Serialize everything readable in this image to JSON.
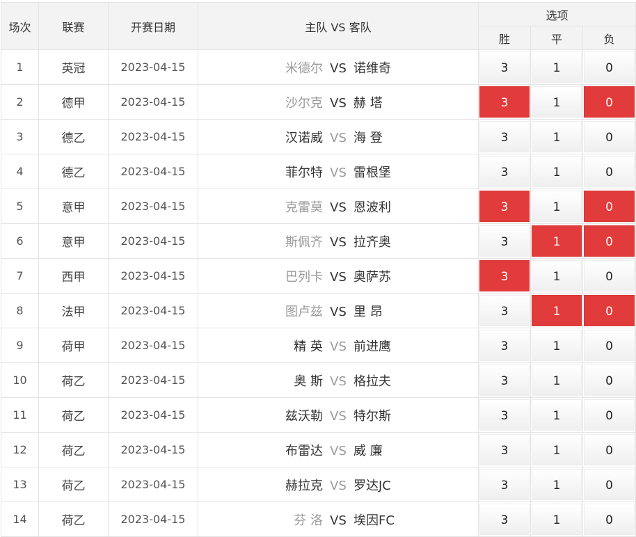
{
  "header": {
    "col_no": "场次",
    "col_league": "联赛",
    "col_date": "开赛日期",
    "col_match": "主队 VS 客队",
    "col_options": "选项",
    "opt_win": "胜",
    "opt_draw": "平",
    "opt_lose": "负"
  },
  "rows": [
    {
      "no": "1",
      "league": "英冠",
      "date": "2023-04-15",
      "home": "米德尔",
      "vs": "VS",
      "away": "诺维奇",
      "home_muted": true,
      "win": "3",
      "draw": "1",
      "lose": "0",
      "sel": [
        false,
        false,
        false
      ]
    },
    {
      "no": "2",
      "league": "德甲",
      "date": "2023-04-15",
      "home": "沙尔克",
      "vs": "VS",
      "away": "赫 塔",
      "home_muted": true,
      "win": "3",
      "draw": "1",
      "lose": "0",
      "sel": [
        true,
        false,
        true
      ]
    },
    {
      "no": "3",
      "league": "德乙",
      "date": "2023-04-15",
      "home": "汉诺威",
      "vs": "VS",
      "away": "海 登",
      "home_muted": false,
      "win": "3",
      "draw": "1",
      "lose": "0",
      "sel": [
        false,
        false,
        false
      ]
    },
    {
      "no": "4",
      "league": "德乙",
      "date": "2023-04-15",
      "home": "菲尔特",
      "vs": "VS",
      "away": "雷根堡",
      "home_muted": false,
      "win": "3",
      "draw": "1",
      "lose": "0",
      "sel": [
        false,
        false,
        false
      ]
    },
    {
      "no": "5",
      "league": "意甲",
      "date": "2023-04-15",
      "home": "克雷莫",
      "vs": "VS",
      "away": "恩波利",
      "home_muted": true,
      "win": "3",
      "draw": "1",
      "lose": "0",
      "sel": [
        true,
        false,
        true
      ]
    },
    {
      "no": "6",
      "league": "意甲",
      "date": "2023-04-15",
      "home": "斯佩齐",
      "vs": "VS",
      "away": "拉齐奥",
      "home_muted": true,
      "win": "3",
      "draw": "1",
      "lose": "0",
      "sel": [
        false,
        true,
        true
      ]
    },
    {
      "no": "7",
      "league": "西甲",
      "date": "2023-04-15",
      "home": "巴列卡",
      "vs": "VS",
      "away": "奥萨苏",
      "home_muted": true,
      "win": "3",
      "draw": "1",
      "lose": "0",
      "sel": [
        true,
        false,
        false
      ]
    },
    {
      "no": "8",
      "league": "法甲",
      "date": "2023-04-15",
      "home": "图卢兹",
      "vs": "VS",
      "away": "里 昂",
      "home_muted": true,
      "win": "3",
      "draw": "1",
      "lose": "0",
      "sel": [
        false,
        true,
        true
      ]
    },
    {
      "no": "9",
      "league": "荷甲",
      "date": "2023-04-15",
      "home": "精 英",
      "vs": "VS",
      "away": "前进鹰",
      "home_muted": false,
      "win": "3",
      "draw": "1",
      "lose": "0",
      "sel": [
        false,
        false,
        false
      ]
    },
    {
      "no": "10",
      "league": "荷乙",
      "date": "2023-04-15",
      "home": "奥 斯",
      "vs": "VS",
      "away": "格拉夫",
      "home_muted": false,
      "win": "3",
      "draw": "1",
      "lose": "0",
      "sel": [
        false,
        false,
        false
      ]
    },
    {
      "no": "11",
      "league": "荷乙",
      "date": "2023-04-15",
      "home": "兹沃勒",
      "vs": "VS",
      "away": "特尔斯",
      "home_muted": false,
      "win": "3",
      "draw": "1",
      "lose": "0",
      "sel": [
        false,
        false,
        false
      ]
    },
    {
      "no": "12",
      "league": "荷乙",
      "date": "2023-04-15",
      "home": "布雷达",
      "vs": "VS",
      "away": "威 廉",
      "home_muted": false,
      "win": "3",
      "draw": "1",
      "lose": "0",
      "sel": [
        false,
        false,
        false
      ]
    },
    {
      "no": "13",
      "league": "荷乙",
      "date": "2023-04-15",
      "home": "赫拉克",
      "vs": "VS",
      "away": "罗达JC",
      "home_muted": false,
      "win": "3",
      "draw": "1",
      "lose": "0",
      "sel": [
        false,
        false,
        false
      ]
    },
    {
      "no": "14",
      "league": "荷乙",
      "date": "2023-04-15",
      "home": "芬 洛",
      "vs": "VS",
      "away": "埃因FC",
      "home_muted": true,
      "win": "3",
      "draw": "1",
      "lose": "0",
      "sel": [
        false,
        false,
        false
      ]
    }
  ],
  "colors": {
    "selected": "#e23b3b",
    "muted_text": "#9a9a9a",
    "header_bg": "#f3f3f3"
  }
}
